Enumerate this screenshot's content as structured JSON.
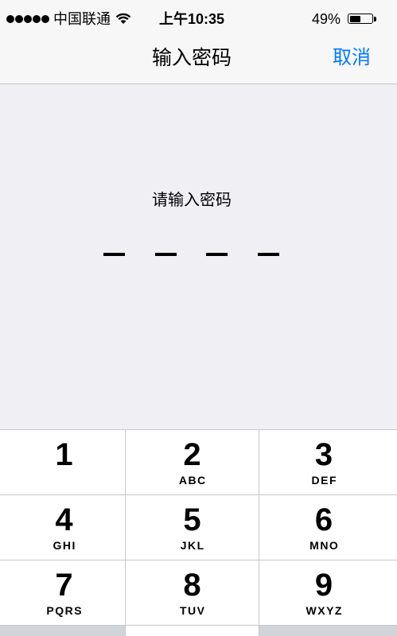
{
  "status_bar": {
    "signal_strength": 5,
    "carrier": "中国联通",
    "wifi_icon": "wifi-icon",
    "time": "上午10:35",
    "battery_percent": "49%",
    "battery_level": 0.49,
    "battery_icon": "battery-icon"
  },
  "nav_bar": {
    "title": "输入密码",
    "cancel_label": "取消"
  },
  "passcode": {
    "prompt": "请输入密码",
    "slot_count": 4,
    "filled_count": 0
  },
  "keypad": {
    "keys": [
      {
        "digit": "1"
      },
      {
        "digit": "2",
        "letters": "ABC"
      },
      {
        "digit": "3",
        "letters": "DEF"
      },
      {
        "digit": "4",
        "letters": "GHI"
      },
      {
        "digit": "5",
        "letters": "JKL"
      },
      {
        "digit": "6",
        "letters": "MNO"
      },
      {
        "digit": "7",
        "letters": "PQRS"
      },
      {
        "digit": "8",
        "letters": "TUV"
      },
      {
        "digit": "9",
        "letters": "WXYZ"
      }
    ]
  },
  "colors": {
    "accent": "#007aff"
  }
}
